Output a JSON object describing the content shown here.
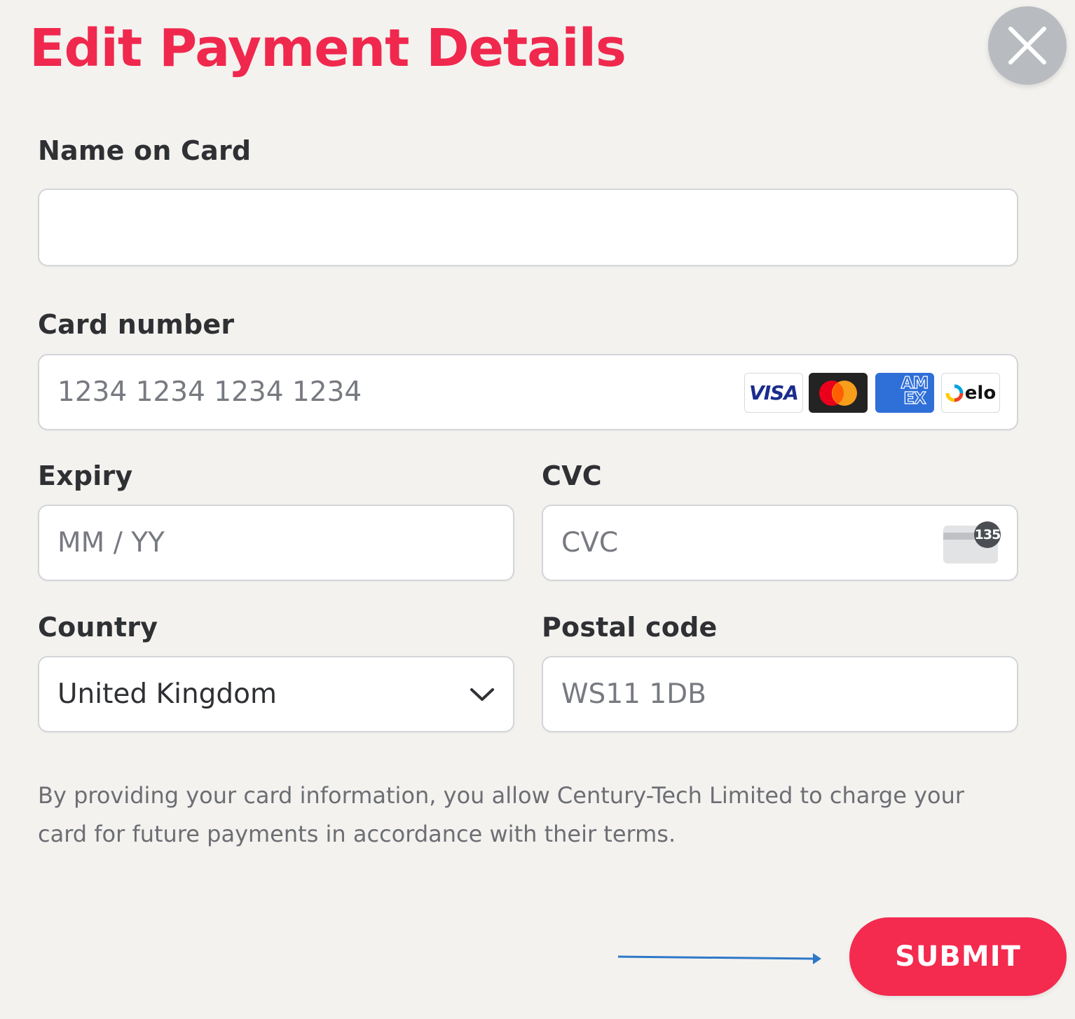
{
  "dialog": {
    "title": "Edit Payment Details",
    "close_icon": "close-x-icon"
  },
  "form": {
    "name_on_card": {
      "label": "Name on Card",
      "value": "",
      "placeholder": ""
    },
    "card_number": {
      "label": "Card number",
      "placeholder": "1234 1234 1234 1234",
      "brands": [
        {
          "name": "VISA",
          "icon": "visa-icon"
        },
        {
          "name": "Mastercard",
          "icon": "mastercard-icon"
        },
        {
          "name": "AM EX",
          "icon": "amex-icon"
        },
        {
          "name": "elo",
          "icon": "elo-icon"
        }
      ]
    },
    "expiry": {
      "label": "Expiry",
      "placeholder": "MM / YY"
    },
    "cvc": {
      "label": "CVC",
      "placeholder": "CVC",
      "hint_badge": "135"
    },
    "country": {
      "label": "Country",
      "value": "United Kingdom"
    },
    "postal_code": {
      "label": "Postal code",
      "placeholder": "WS11 1DB"
    }
  },
  "notice": "By providing your card information, you allow Century-Tech Limited to charge your card for future payments in accordance with their terms.",
  "submit_label": "SUBMIT",
  "colors": {
    "accent": "#f0284d",
    "background": "#f3f2ef",
    "arrow": "#2e78c7"
  }
}
